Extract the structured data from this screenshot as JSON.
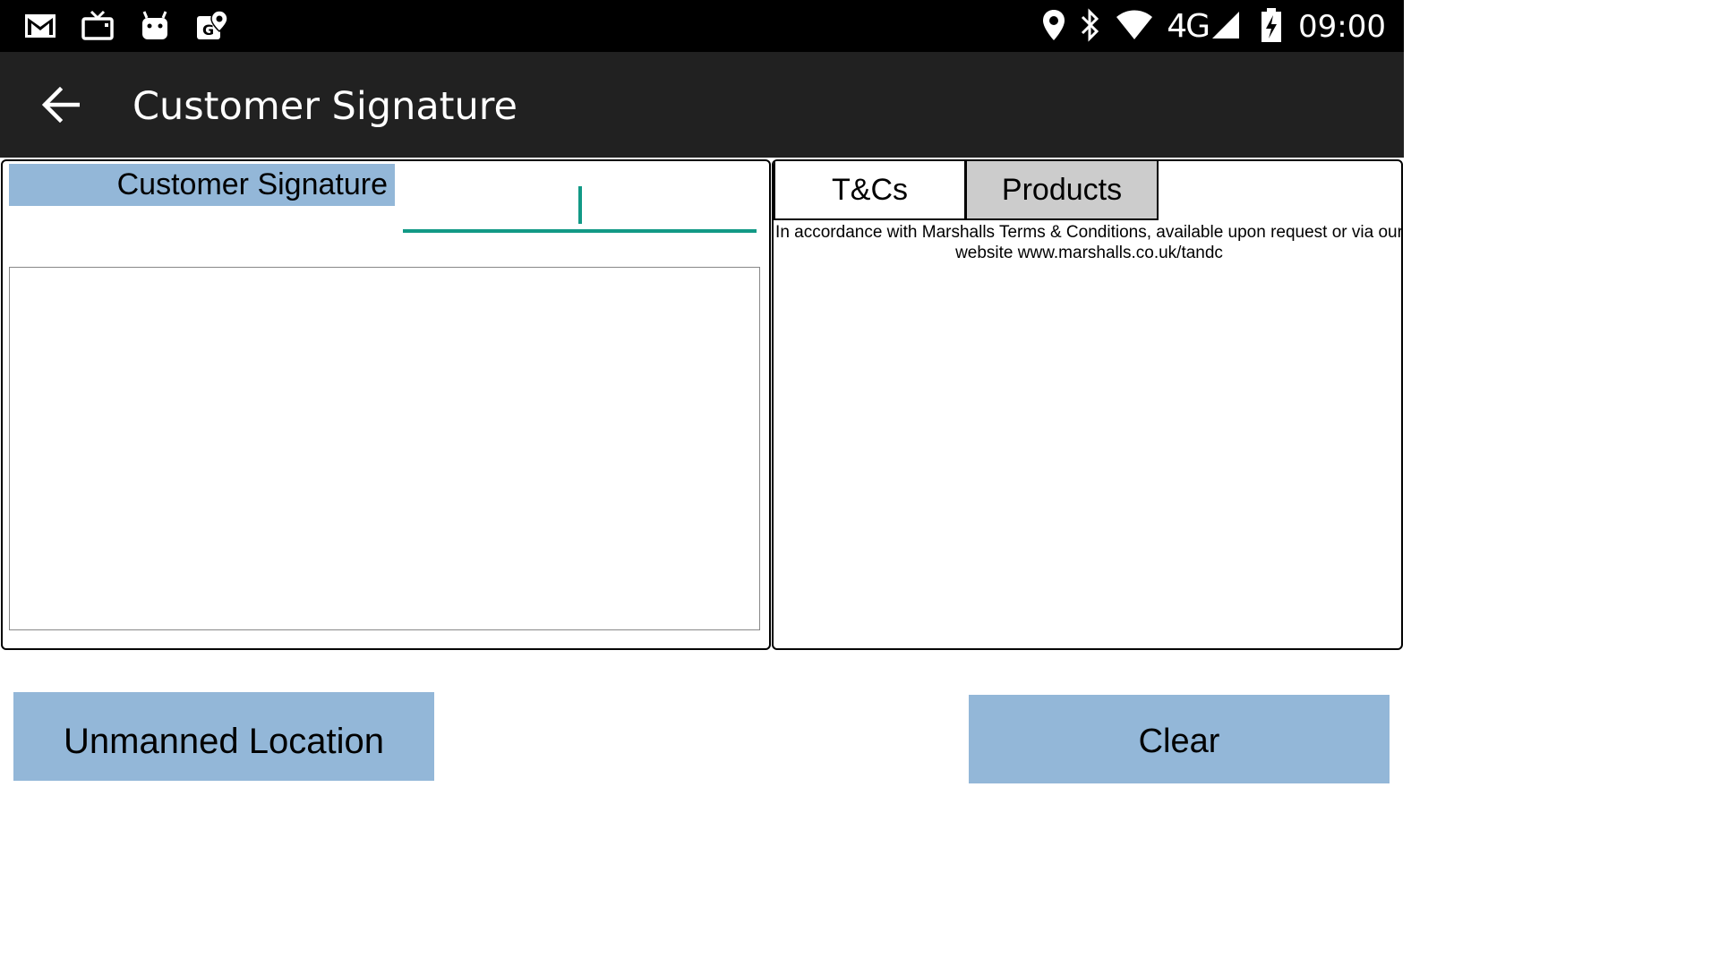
{
  "statusbar": {
    "left_icons": [
      "gmail-icon",
      "tv-icon",
      "android-icon",
      "maps-icon"
    ],
    "right_icons": [
      "location-icon",
      "bluetooth-icon",
      "wifi-icon",
      "signal-icon",
      "battery-charging-icon"
    ],
    "network": "4G",
    "time": "09:00"
  },
  "appbar": {
    "back_icon": "arrow-left-icon",
    "title": "Customer Signature"
  },
  "left_panel": {
    "label": "Customer Signature",
    "name_input_value": ""
  },
  "right_panel": {
    "tabs": [
      {
        "label": "T&Cs",
        "selected": true
      },
      {
        "label": "Products",
        "selected": false
      }
    ],
    "tcs_text_line1": "In accordance with Marshalls Terms & Conditions, available upon request or via our",
    "tcs_text_line2": "website www.marshalls.co.uk/tandc"
  },
  "buttons": {
    "unmanned_location": "Unmanned Location",
    "clear": "Clear"
  },
  "colors": {
    "button_bg": "#93b7d8",
    "accent": "#129986",
    "appbar_bg": "#212121",
    "selected_tab_bg": "#cccccc"
  }
}
